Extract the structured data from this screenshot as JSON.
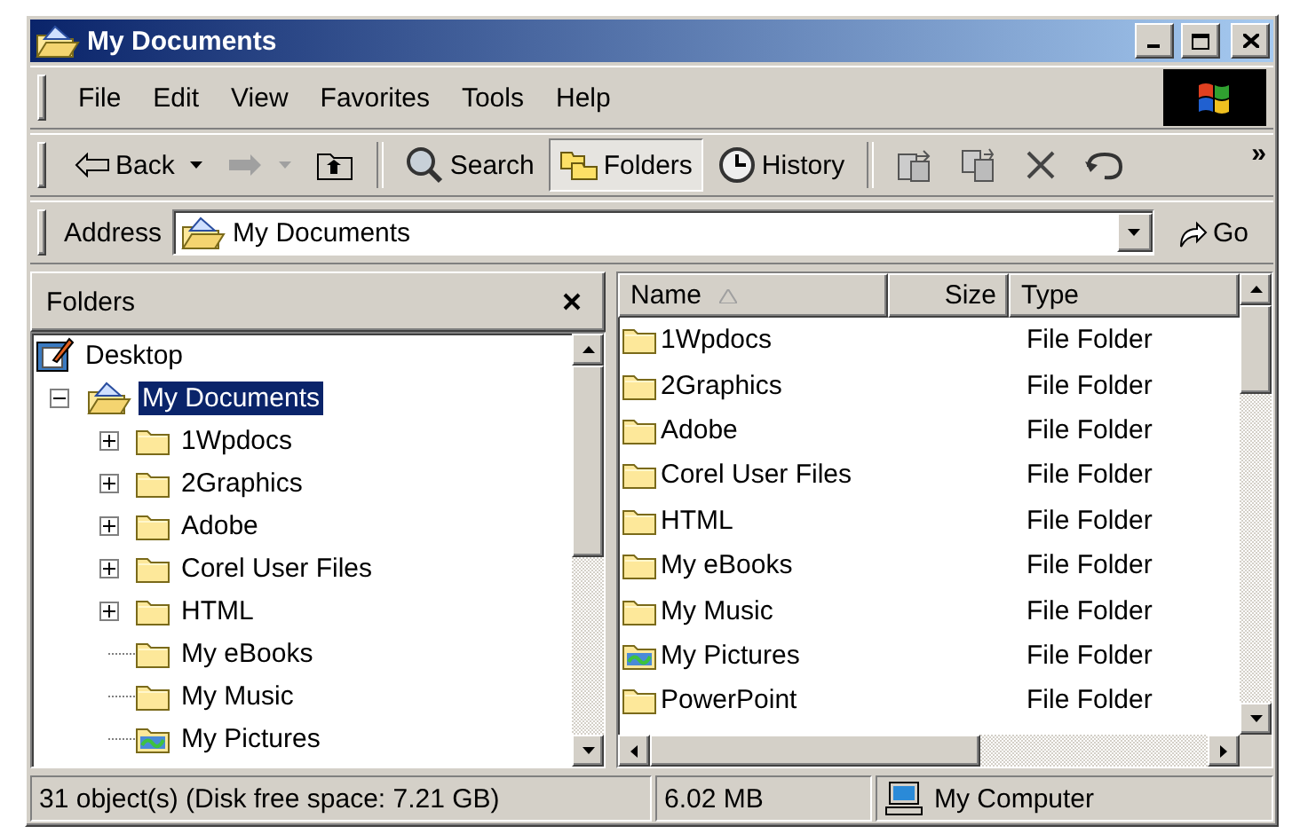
{
  "window": {
    "title": "My Documents"
  },
  "menu": [
    "File",
    "Edit",
    "View",
    "Favorites",
    "Tools",
    "Help"
  ],
  "toolbar": [
    {
      "kind": "back",
      "label": "Back",
      "disabled": false
    },
    {
      "kind": "forward",
      "disabled": true
    },
    {
      "kind": "up"
    },
    {
      "kind": "separator"
    },
    {
      "kind": "search",
      "label": "Search",
      "selected": false
    },
    {
      "kind": "folders",
      "label": "Folders",
      "selected": true
    },
    {
      "kind": "history",
      "label": "History",
      "selected": false
    },
    {
      "kind": "separator"
    },
    {
      "kind": "move"
    },
    {
      "kind": "copy"
    },
    {
      "kind": "delete"
    },
    {
      "kind": "undo"
    }
  ],
  "toolbar_overflow": "»",
  "address": {
    "label": "Address",
    "value": "My Documents",
    "go": "Go"
  },
  "folders_pane": {
    "title": "Folders",
    "tree": [
      {
        "label": "Desktop",
        "kind": "desktop",
        "selected": false,
        "children": [
          {
            "label": "My Documents",
            "kind": "documents",
            "expanded": true,
            "selected": true,
            "children": [
              {
                "label": "1Wpdocs",
                "kind": "folder",
                "expanded": false,
                "selected": false
              },
              {
                "label": "2Graphics",
                "kind": "folder",
                "expanded": false,
                "selected": false
              },
              {
                "label": "Adobe",
                "kind": "folder",
                "expanded": false,
                "selected": false
              },
              {
                "label": "Corel User Files",
                "kind": "folder",
                "expanded": false,
                "selected": false
              },
              {
                "label": "HTML",
                "kind": "folder",
                "expanded": false,
                "selected": false
              },
              {
                "label": "My eBooks",
                "kind": "folder",
                "selected": false
              },
              {
                "label": "My Music",
                "kind": "folder",
                "selected": false
              },
              {
                "label": "My Pictures",
                "kind": "pictures",
                "selected": false
              }
            ]
          }
        ]
      }
    ]
  },
  "list": {
    "columns": [
      {
        "label": "Name",
        "sorted": true
      },
      {
        "label": "Size",
        "sorted": false
      },
      {
        "label": "Type",
        "sorted": false
      }
    ],
    "rows": [
      {
        "name": "1Wpdocs",
        "kind": "folder",
        "type": "File Folder",
        "selected": false
      },
      {
        "name": "2Graphics",
        "kind": "folder",
        "type": "File Folder",
        "selected": false
      },
      {
        "name": "Adobe",
        "kind": "folder",
        "type": "File Folder",
        "selected": false
      },
      {
        "name": "Corel User Files",
        "kind": "folder",
        "type": "File Folder",
        "selected": false
      },
      {
        "name": "HTML",
        "kind": "folder",
        "type": "File Folder",
        "selected": false
      },
      {
        "name": "My eBooks",
        "kind": "folder",
        "type": "File Folder",
        "selected": false
      },
      {
        "name": "My Music",
        "kind": "folder",
        "type": "File Folder",
        "selected": false
      },
      {
        "name": "My Pictures",
        "kind": "pictures",
        "type": "File Folder",
        "selected": false
      },
      {
        "name": "PowerPoint",
        "kind": "folder",
        "type": "File Folder",
        "selected": false
      }
    ]
  },
  "status": [
    {
      "text": "31 object(s) (Disk free space: 7.21 GB)"
    },
    {
      "text": "6.02 MB"
    },
    {
      "text": "My Computer",
      "kind": "computer"
    }
  ]
}
